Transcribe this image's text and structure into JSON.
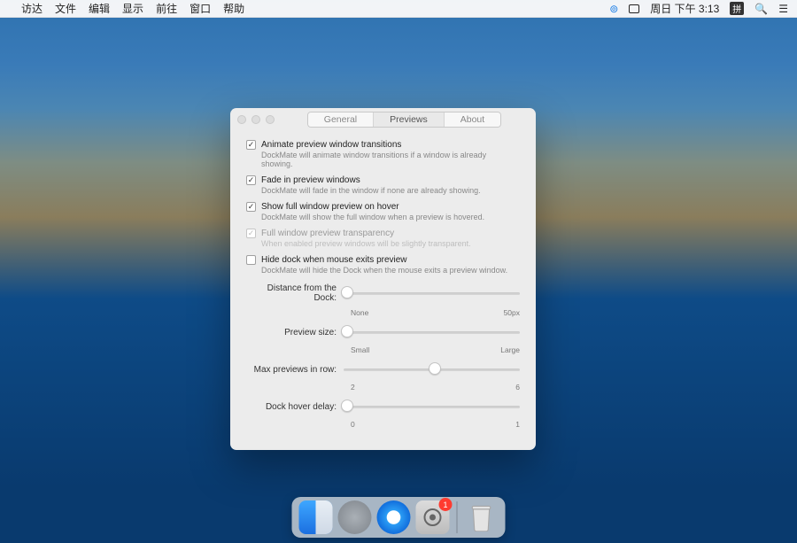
{
  "menubar": {
    "items": [
      "访达",
      "文件",
      "编辑",
      "显示",
      "前往",
      "窗口",
      "帮助"
    ],
    "status": {
      "date": "周日 下午 3:13",
      "ime": "拼"
    }
  },
  "window": {
    "tabs": {
      "general": "General",
      "previews": "Previews",
      "about": "About"
    },
    "options": [
      {
        "checked": true,
        "disabled": false,
        "title": "Animate preview window transitions",
        "desc": "DockMate will animate window transitions if a window is already showing."
      },
      {
        "checked": true,
        "disabled": false,
        "title": "Fade in preview windows",
        "desc": "DockMate will fade in the window if none are already showing."
      },
      {
        "checked": true,
        "disabled": false,
        "title": "Show full window preview on hover",
        "desc": "DockMate will show the full window when a preview is hovered."
      },
      {
        "checked": true,
        "disabled": true,
        "title": "Full window preview transparency",
        "desc": "When enabled preview windows will be slightly transparent."
      },
      {
        "checked": false,
        "disabled": false,
        "title": "Hide dock when mouse exits preview",
        "desc": "DockMate will hide the Dock when the mouse exits a preview window."
      }
    ],
    "sliders": [
      {
        "label": "Distance from the Dock:",
        "pos": 2,
        "min": "None",
        "max": "50px"
      },
      {
        "label": "Preview size:",
        "pos": 2,
        "min": "Small",
        "max": "Large"
      },
      {
        "label": "Max previews in row:",
        "pos": 52,
        "min": "2",
        "max": "6"
      },
      {
        "label": "Dock hover delay:",
        "pos": 2,
        "min": "0",
        "max": "1"
      }
    ]
  },
  "dock": {
    "badge": "1"
  }
}
